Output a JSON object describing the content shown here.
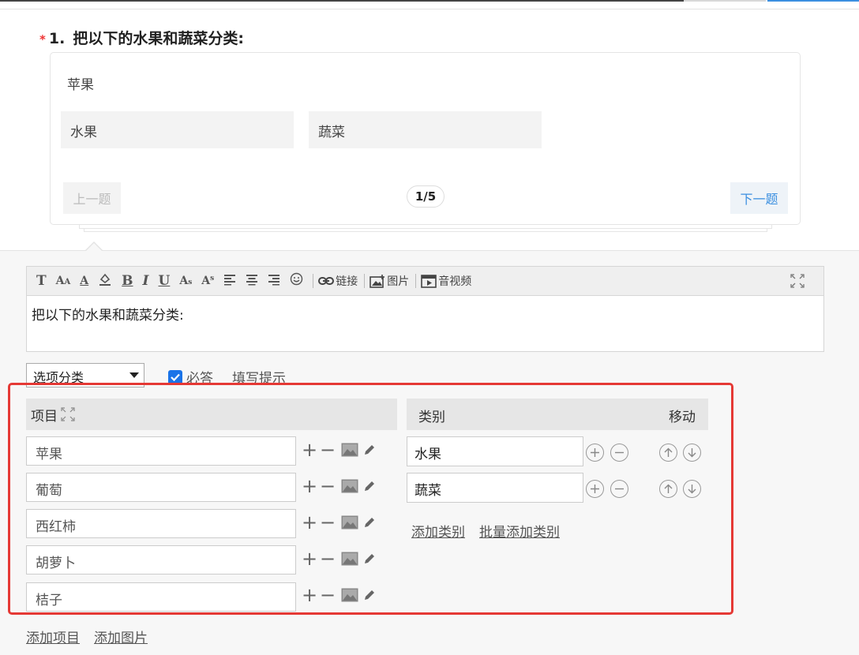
{
  "question": {
    "required_mark": "*",
    "number": "1.",
    "title": "把以下的水果和蔬菜分类:"
  },
  "preview": {
    "current_item": "苹果",
    "categories": [
      "水果",
      "蔬菜"
    ],
    "prev_label": "上一题",
    "next_label": "下一题",
    "pager": "1/5"
  },
  "toolbar": {
    "link_label": "链接",
    "image_label": "图片",
    "media_label": "音视频"
  },
  "editor": {
    "content": "把以下的水果和蔬菜分类:"
  },
  "settings": {
    "type_value": "选项分类",
    "required_label": "必答",
    "required_checked": true,
    "hint_label": "填写提示"
  },
  "items_panel": {
    "header": "项目",
    "items": [
      "苹果",
      "葡萄",
      "西红柿",
      "胡萝卜",
      "桔子"
    ]
  },
  "category_panel": {
    "header_category": "类别",
    "header_move": "移动",
    "categories": [
      "水果",
      "蔬菜"
    ],
    "add_category": "添加类别",
    "batch_add_category": "批量添加类别"
  },
  "bottom_links": {
    "add_item": "添加项目",
    "add_image": "添加图片"
  },
  "colors": {
    "required_star": "#e33333",
    "link_blue": "#3b8fe0",
    "checkbox_blue": "#1a73e8",
    "highlight_frame": "#e53935"
  }
}
